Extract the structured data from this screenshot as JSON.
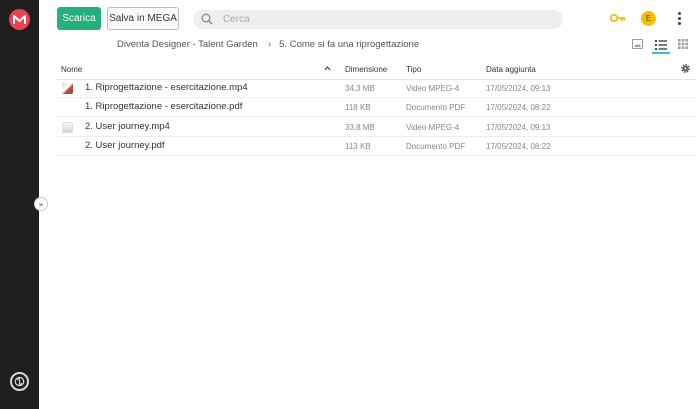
{
  "toolbar": {
    "download_label": "Scarica",
    "save_label": "Salva in MEGA"
  },
  "search": {
    "placeholder": "Cerca"
  },
  "account": {
    "avatar_initial": "E"
  },
  "breadcrumb": {
    "items": [
      "Diventa Designer - Talent Garden",
      "5. Come si fa una riprogettazione"
    ],
    "separator": "›"
  },
  "table": {
    "columns": {
      "name": "Nome",
      "size": "Dimensione",
      "type": "Tipo",
      "date": "Data aggiunta"
    },
    "rows": [
      {
        "name": "1. Riprogettazione - esercitazione.mp4",
        "size": "34,3 MB",
        "type": "Video MPEG-4",
        "date": "17/05/2024, 09:13"
      },
      {
        "name": "1. Riprogettazione - esercitazione.pdf",
        "size": "118 KB",
        "type": "Documento PDF",
        "date": "17/05/2024, 08:22"
      },
      {
        "name": "2. User journey.mp4",
        "size": "33,8 MB",
        "type": "Video MPEG-4",
        "date": "17/05/2024, 09:13"
      },
      {
        "name": "2. User journey.pdf",
        "size": "113 KB",
        "type": "Documento PDF",
        "date": "17/05/2024, 08:22"
      }
    ]
  },
  "colors": {
    "rail": "#1f1f1f",
    "brand_red": "#e8444f",
    "primary_green": "#23b07d",
    "avatar_yellow": "#f2c200",
    "key_yellow": "#e8c21a",
    "active_view_teal": "#2dc5c5"
  },
  "icons": {
    "logo": "mega-logo-icon",
    "search": "search-icon",
    "key": "key-icon",
    "menu": "kebab-menu-icon",
    "view_thumbnails": "thumbnail-view-icon",
    "view_list": "list-view-icon",
    "view_grid": "grid-view-icon",
    "sort": "chevron-up-icon",
    "settings": "gear-icon",
    "sidebar_toggle": "double-chevron-right-icon",
    "transfers": "transfers-icon"
  }
}
